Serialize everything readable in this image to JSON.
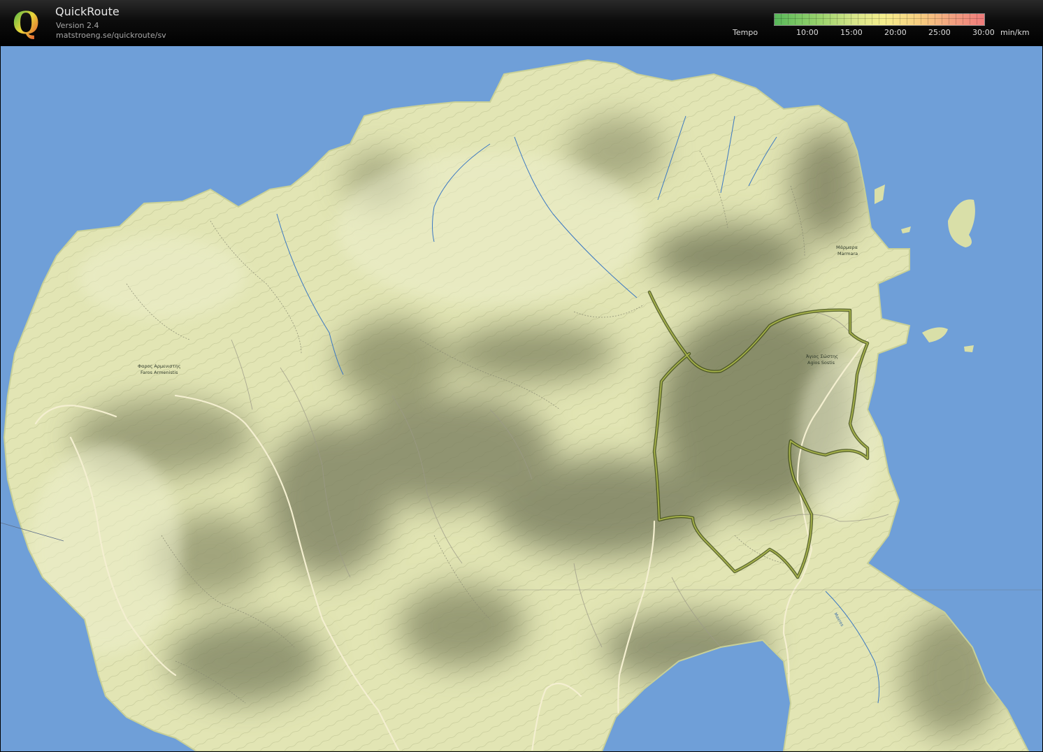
{
  "header": {
    "app_name": "QuickRoute",
    "version": "Version 2.4",
    "url": "matstroeng.se/quickroute/sv",
    "logo_letter": "Q"
  },
  "legend": {
    "label": "Tempo",
    "ticks": [
      "10:00",
      "15:00",
      "20:00",
      "25:00",
      "30:00"
    ],
    "unit": "min/km",
    "colors": [
      "#58b85a",
      "#d8e68a",
      "#f5ee8d",
      "#f7cc80",
      "#ef7a7a"
    ]
  },
  "map": {
    "labels": {
      "faros_greek": "Φαρος Αρμενιστης",
      "faros_latin": "Faros Armenistis",
      "marmara_greek": "Μάρμαρα",
      "marmara_latin": "Marmara",
      "agios_greek": "Άγιος Σώστης",
      "agios_latin": "Agios Sostis",
      "stream": "Mavros"
    },
    "colors": {
      "sea": "#6f9fd8",
      "land": "#e1e4b2",
      "route": "#6b7d2b"
    }
  }
}
